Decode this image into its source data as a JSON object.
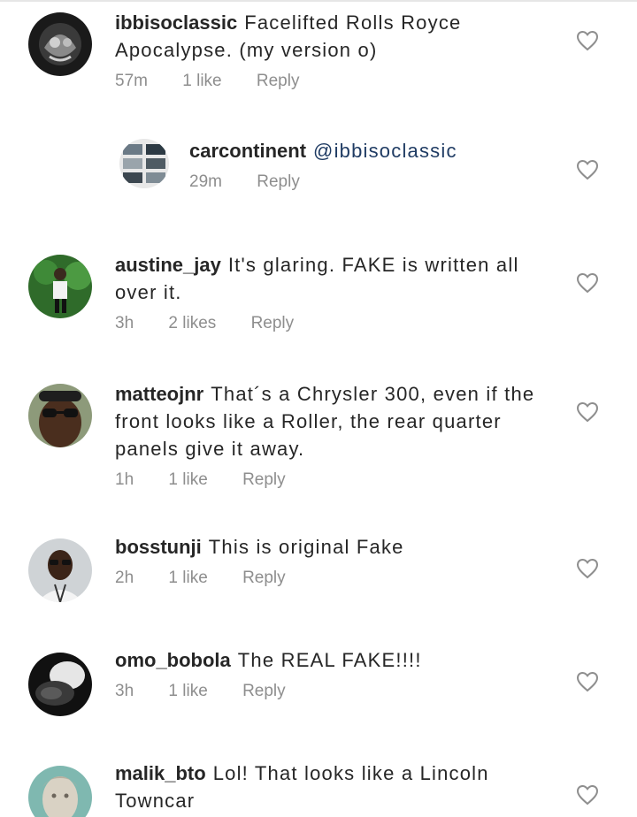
{
  "heart_icon": "heart-outline-icon",
  "comments": [
    {
      "username": "ibbisoclassic",
      "text": "Facelifted Rolls Royce Apocalypse. (my version o)",
      "time": "57m",
      "likes": "1 like",
      "reply": "Reply"
    },
    {
      "username": "carcontinent",
      "mention": "@ibbisoclassic",
      "text": "",
      "time": "29m",
      "reply": "Reply"
    },
    {
      "username": "austine_jay",
      "text": "It's glaring. FAKE is written all over it.",
      "time": "3h",
      "likes": "2 likes",
      "reply": "Reply"
    },
    {
      "username": "matteojnr",
      "text": "That´s a Chrysler 300, even if the front looks like a Roller, the rear quarter panels give it away.",
      "time": "1h",
      "likes": "1 like",
      "reply": "Reply"
    },
    {
      "username": "bosstunji",
      "text": "This is original Fake",
      "time": "2h",
      "likes": "1 like",
      "reply": "Reply"
    },
    {
      "username": "omo_bobola",
      "text": "The REAL FAKE!!!!",
      "time": "3h",
      "likes": "1 like",
      "reply": "Reply"
    },
    {
      "username": "malik_bto",
      "text": "Lol! That looks like a Lincoln Towncar",
      "time": "",
      "likes": "",
      "reply": ""
    }
  ]
}
